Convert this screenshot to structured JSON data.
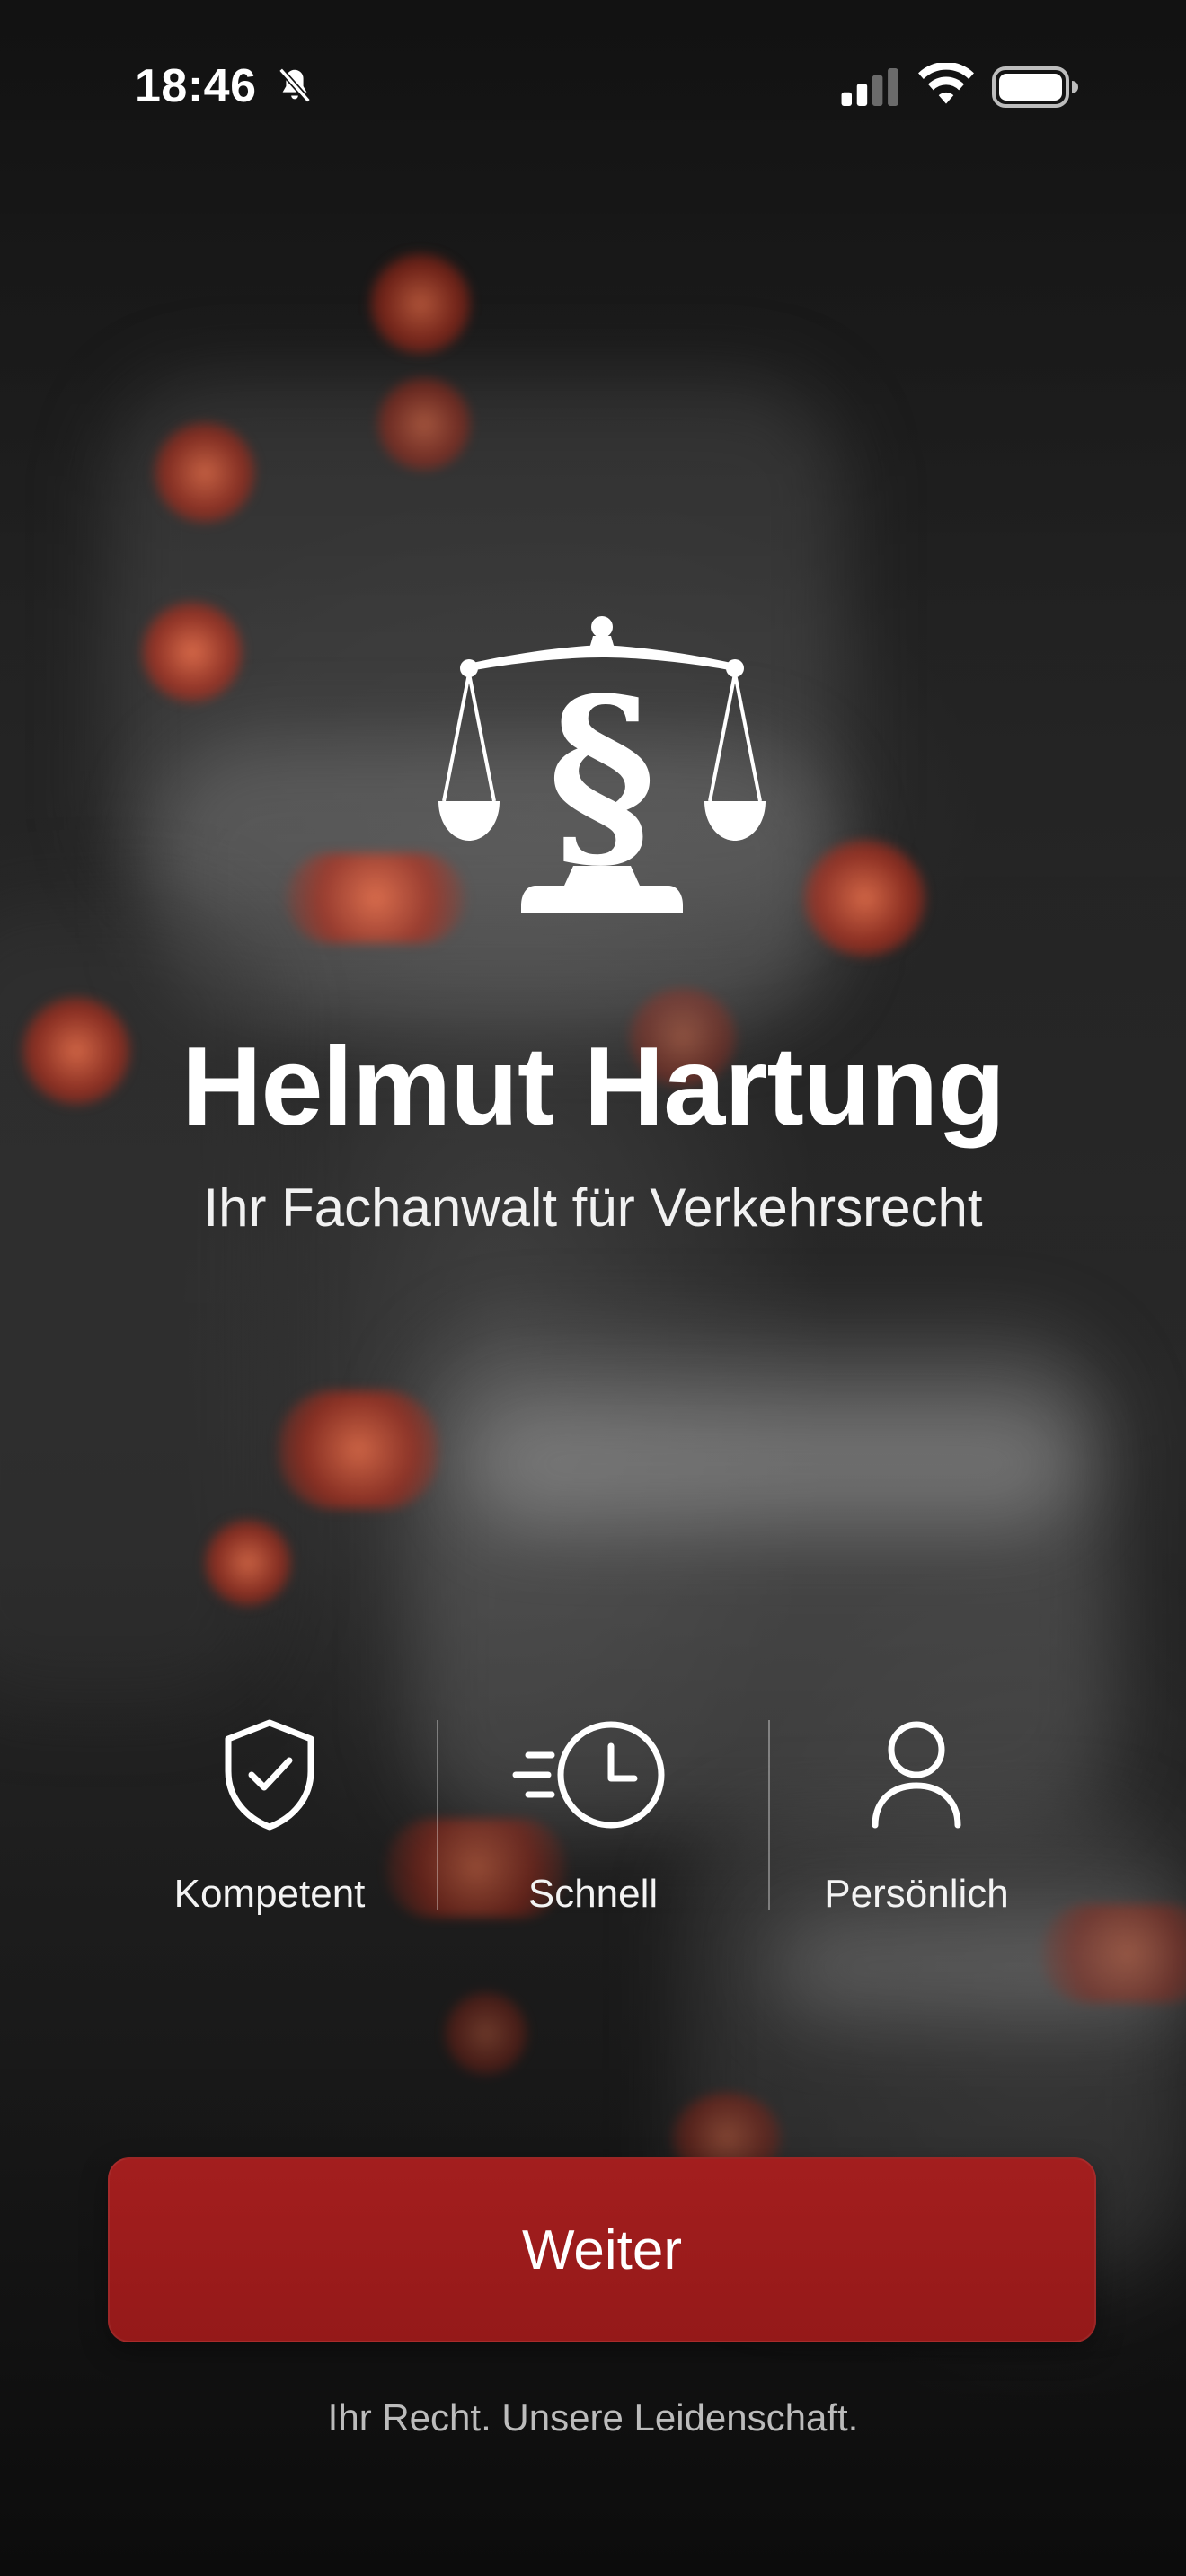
{
  "status_bar": {
    "time": "18:46",
    "icons": [
      "bell-slash-icon",
      "cellular-signal-icon",
      "wifi-icon",
      "battery-icon"
    ]
  },
  "logo": {
    "icon": "scales-of-justice-paragraph-icon"
  },
  "hero": {
    "title": "Helmut Hartung",
    "subtitle": "Ihr Fachanwalt für Verkehrsrecht"
  },
  "features": [
    {
      "icon": "shield-check-icon",
      "label": "Kompetent"
    },
    {
      "icon": "clock-speed-icon",
      "label": "Schnell"
    },
    {
      "icon": "person-icon",
      "label": "Persönlich"
    }
  ],
  "actions": {
    "continue_label": "Weiter"
  },
  "footer": {
    "tagline": "Ihr Recht. Unsere Leidenschaft."
  },
  "colors": {
    "accent": "#9B1C1C",
    "text": "#FFFFFF",
    "background": "#1E1E1E"
  }
}
